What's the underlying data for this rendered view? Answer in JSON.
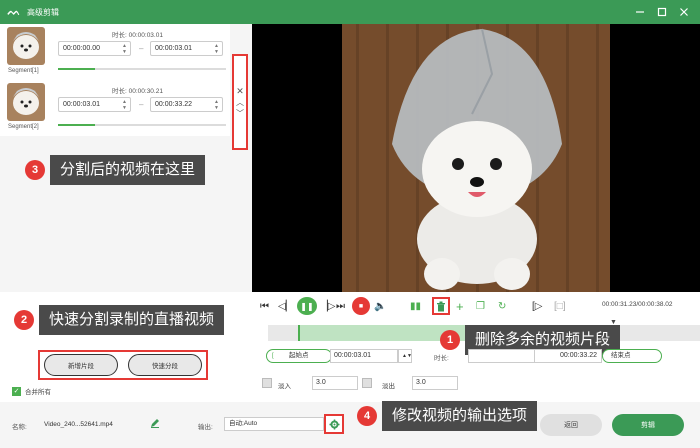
{
  "window": {
    "title": "高级剪辑"
  },
  "segments": [
    {
      "label": "Segment[1]",
      "duration_label": "时长:",
      "duration": "00:00:03.01",
      "start": "00:00:00.00",
      "end": "00:00:03.01",
      "progress": 0.22
    },
    {
      "label": "Segment[2]",
      "duration_label": "时长:",
      "duration": "00:00:30.21",
      "start": "00:00:03.01",
      "end": "00:00:33.22",
      "progress": 0.22
    }
  ],
  "callouts": [
    {
      "number": "3",
      "text": "分割后的视频在这里"
    },
    {
      "number": "2",
      "text": "快速分割录制的直播视频"
    },
    {
      "number": "1",
      "text": "删除多余的视频片段"
    },
    {
      "number": "4",
      "text": "修改视频的输出选项"
    }
  ],
  "player": {
    "time_readout": "00:00:31.23/00:00:38.02"
  },
  "timeline": {
    "selection_fraction": 0.78
  },
  "trim": {
    "start_label": "起始点",
    "start_value": "00:00:03.01",
    "duration_label": "时长:",
    "end_value": "00:00:33.22",
    "end_label": "结束点"
  },
  "fade": {
    "in_label": "淡入",
    "in_value": "3.0",
    "out_label": "淡出",
    "out_value": "3.0"
  },
  "actions": {
    "new_segment": "新增片段",
    "quick_split": "快速分段",
    "merge_all": "合并所有"
  },
  "footer": {
    "name_label": "名称:",
    "file_name": "Video_240...52641.mp4",
    "output_label": "输出:",
    "output_value": "自动;Auto",
    "back_label": "返回",
    "cut_label": "剪辑"
  },
  "colors": {
    "accent": "#3b9a56",
    "highlight": "#e53935"
  }
}
